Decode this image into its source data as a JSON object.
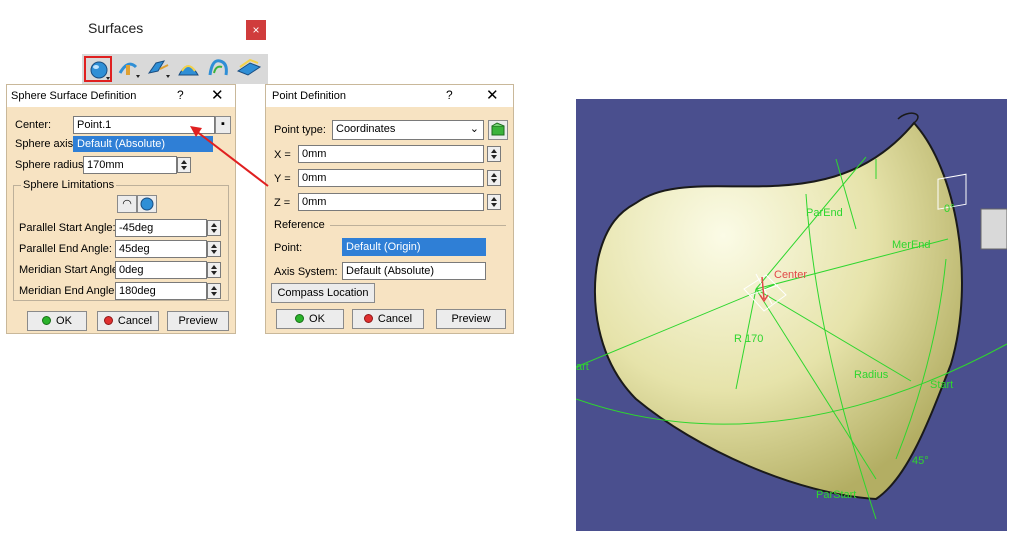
{
  "toolbar": {
    "title": "Surfaces",
    "close": "×",
    "icons": [
      "sphere-icon",
      "revolve-icon",
      "extrude-icon",
      "offset-icon",
      "sweep-icon",
      "fill-icon"
    ]
  },
  "sphere_dialog": {
    "title": "Sphere Surface Definition",
    "help": "?",
    "close": "✕",
    "center_label": "Center:",
    "center_value": "Point.1",
    "axis_label": "Sphere axis:",
    "axis_value": "Default (Absolute)",
    "radius_label": "Sphere radius:",
    "radius_value": "170mm",
    "limits_title": "Sphere Limitations",
    "parallel_start_label": "Parallel Start Angle:",
    "parallel_start_value": "-45deg",
    "parallel_end_label": "Parallel End Angle:",
    "parallel_end_value": "45deg",
    "meridian_start_label": "Meridian Start Angle:",
    "meridian_start_value": "0deg",
    "meridian_end_label": "Meridian End Angle:",
    "meridian_end_value": "180deg",
    "ok": "OK",
    "cancel": "Cancel",
    "preview": "Preview"
  },
  "point_dialog": {
    "title": "Point Definition",
    "help": "?",
    "close": "✕",
    "type_label": "Point type:",
    "type_value": "Coordinates",
    "x_label": "X =",
    "x_value": "0mm",
    "y_label": "Y =",
    "y_value": "0mm",
    "z_label": "Z =",
    "z_value": "0mm",
    "reference_title": "Reference",
    "point_label": "Point:",
    "point_value": "Default (Origin)",
    "axis_label": "Axis System:",
    "axis_value": "Default (Absolute)",
    "compass": "Compass Location",
    "ok": "OK",
    "cancel": "Cancel",
    "preview": "Preview"
  },
  "viewport": {
    "labels": {
      "parend": "ParEnd",
      "merend": "MerEnd",
      "center": "Center",
      "r170": "R 170",
      "radius": "Radius",
      "start": "Start",
      "parstart": "ParStart",
      "art": "art",
      "deg": "45°",
      "deg2": "0°"
    },
    "colors": {
      "background": "#4a4f8e",
      "surface": "#e8e6b4",
      "lines": "#2ed62e",
      "center": "#e04848"
    }
  }
}
